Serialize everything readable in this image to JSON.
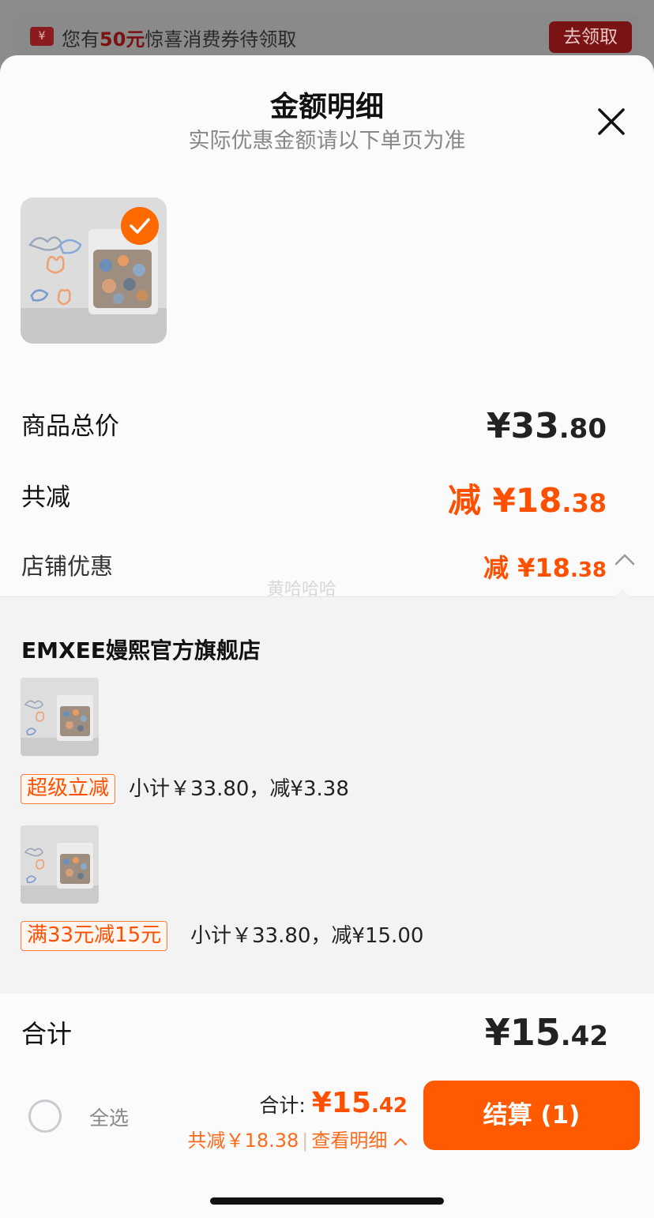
{
  "banner": {
    "prefix": "您有",
    "amount": "50元",
    "suffix": "惊喜消费券待领取",
    "ticket_icon_text": "¥",
    "claim_label": "去领取"
  },
  "sheet": {
    "title": "金额明细",
    "subtitle": "实际优惠金额请以下单页为准"
  },
  "summary": {
    "goods_total_label": "商品总价",
    "goods_total_int": "¥33",
    "goods_total_dec": ".80",
    "reduce_label": "共减",
    "reduce_int": "减 ¥18",
    "reduce_dec": ".38",
    "shop_discount_label": "店铺优惠",
    "shop_discount_int": "减 ¥18",
    "shop_discount_dec": ".38"
  },
  "watermark": "黄哈哈哈",
  "detail": {
    "shop_name": "EMXEE嫚熙官方旗舰店",
    "items": [
      {
        "tag": "超级立减",
        "text": "小计￥33.80，减¥3.38"
      },
      {
        "tag": "满33元减15元",
        "text": "小计￥33.80，减¥15.00"
      }
    ]
  },
  "total": {
    "label": "合计",
    "int": "¥15",
    "dec": ".42"
  },
  "footer": {
    "select_all": "全选",
    "sum_label": "合计: ",
    "sum_int": "¥15",
    "sum_dec": ".42",
    "reduce_text": "共减￥18.38",
    "view_detail": "查看明细",
    "checkout_label": "结算 (1)"
  },
  "colors": {
    "accent": "#ff5000",
    "checkout_bg": "#ff5a00"
  }
}
